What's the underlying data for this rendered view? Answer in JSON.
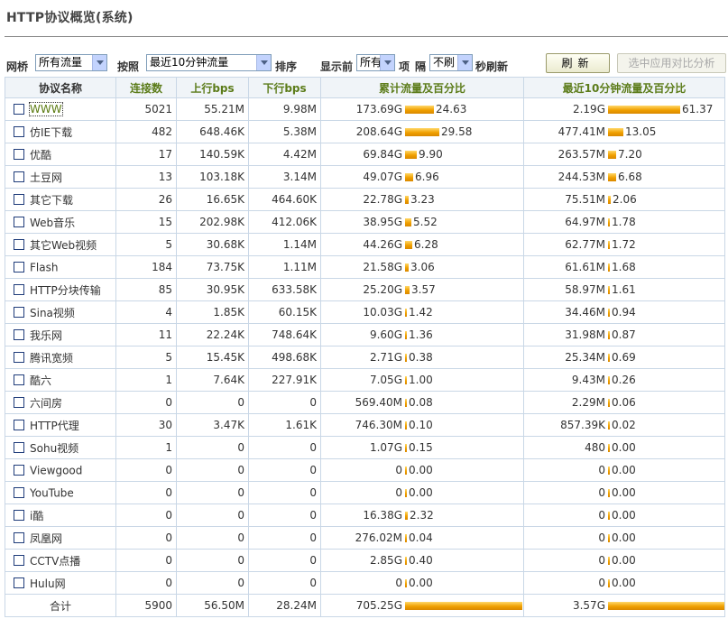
{
  "page": {
    "title": "HTTP协议概览(系统)"
  },
  "toolbar": {
    "bridge_label": "网桥",
    "bridge_value": "所有流量",
    "by_label": "按照",
    "period_value": "最近10分钟流量",
    "sort_label": "排序",
    "show_label": "显示前",
    "show_value": "所有",
    "items_label": "项",
    "interval_label": "隔",
    "refresh_value": "不刷",
    "seconds_label": "秒刷新",
    "refresh_button": "刷新",
    "compare_button": "选中应用对比分析"
  },
  "columns": [
    "协议名称",
    "连接数",
    "上行bps",
    "下行bps",
    "累计流量及百分比",
    "最近10分钟流量及百分比"
  ],
  "rows": [
    {
      "name": "WWW",
      "conns": "5021",
      "up": "55.21M",
      "down": "9.98M",
      "total": "173.69G",
      "total_pct": "24.63",
      "total_frac": 0.2463,
      "recent": "2.19G",
      "recent_pct": "61.37",
      "recent_frac": 0.6137
    },
    {
      "name": "仿IE下载",
      "conns": "482",
      "up": "648.46K",
      "down": "5.38M",
      "total": "208.64G",
      "total_pct": "29.58",
      "total_frac": 0.2958,
      "recent": "477.41M",
      "recent_pct": "13.05",
      "recent_frac": 0.1305
    },
    {
      "name": "优酷",
      "conns": "17",
      "up": "140.59K",
      "down": "4.42M",
      "total": "69.84G",
      "total_pct": "9.90",
      "total_frac": 0.099,
      "recent": "263.57M",
      "recent_pct": "7.20",
      "recent_frac": 0.072
    },
    {
      "name": "土豆网",
      "conns": "13",
      "up": "103.18K",
      "down": "3.14M",
      "total": "49.07G",
      "total_pct": "6.96",
      "total_frac": 0.0696,
      "recent": "244.53M",
      "recent_pct": "6.68",
      "recent_frac": 0.0668
    },
    {
      "name": "其它下载",
      "conns": "26",
      "up": "16.65K",
      "down": "464.60K",
      "total": "22.78G",
      "total_pct": "3.23",
      "total_frac": 0.0323,
      "recent": "75.51M",
      "recent_pct": "2.06",
      "recent_frac": 0.0206
    },
    {
      "name": "Web音乐",
      "conns": "15",
      "up": "202.98K",
      "down": "412.06K",
      "total": "38.95G",
      "total_pct": "5.52",
      "total_frac": 0.0552,
      "recent": "64.97M",
      "recent_pct": "1.78",
      "recent_frac": 0.0178
    },
    {
      "name": "其它Web视频",
      "conns": "5",
      "up": "30.68K",
      "down": "1.14M",
      "total": "44.26G",
      "total_pct": "6.28",
      "total_frac": 0.0628,
      "recent": "62.77M",
      "recent_pct": "1.72",
      "recent_frac": 0.0172
    },
    {
      "name": "Flash",
      "conns": "184",
      "up": "73.75K",
      "down": "1.11M",
      "total": "21.58G",
      "total_pct": "3.06",
      "total_frac": 0.0306,
      "recent": "61.61M",
      "recent_pct": "1.68",
      "recent_frac": 0.0168
    },
    {
      "name": "HTTP分块传输",
      "conns": "85",
      "up": "30.95K",
      "down": "633.58K",
      "total": "25.20G",
      "total_pct": "3.57",
      "total_frac": 0.0357,
      "recent": "58.97M",
      "recent_pct": "1.61",
      "recent_frac": 0.0161
    },
    {
      "name": "Sina视频",
      "conns": "4",
      "up": "1.85K",
      "down": "60.15K",
      "total": "10.03G",
      "total_pct": "1.42",
      "total_frac": 0.0142,
      "recent": "34.46M",
      "recent_pct": "0.94",
      "recent_frac": 0.0094
    },
    {
      "name": "我乐网",
      "conns": "11",
      "up": "22.24K",
      "down": "748.64K",
      "total": "9.60G",
      "total_pct": "1.36",
      "total_frac": 0.0136,
      "recent": "31.98M",
      "recent_pct": "0.87",
      "recent_frac": 0.0087
    },
    {
      "name": "腾讯宽频",
      "conns": "5",
      "up": "15.45K",
      "down": "498.68K",
      "total": "2.71G",
      "total_pct": "0.38",
      "total_frac": 0.0038,
      "recent": "25.34M",
      "recent_pct": "0.69",
      "recent_frac": 0.0069
    },
    {
      "name": "酷六",
      "conns": "1",
      "up": "7.64K",
      "down": "227.91K",
      "total": "7.05G",
      "total_pct": "1.00",
      "total_frac": 0.01,
      "recent": "9.43M",
      "recent_pct": "0.26",
      "recent_frac": 0.0026
    },
    {
      "name": "六间房",
      "conns": "0",
      "up": "0",
      "down": "0",
      "total": "569.40M",
      "total_pct": "0.08",
      "total_frac": 0.0008,
      "recent": "2.29M",
      "recent_pct": "0.06",
      "recent_frac": 0.0006
    },
    {
      "name": "HTTP代理",
      "conns": "30",
      "up": "3.47K",
      "down": "1.61K",
      "total": "746.30M",
      "total_pct": "0.10",
      "total_frac": 0.001,
      "recent": "857.39K",
      "recent_pct": "0.02",
      "recent_frac": 0.0002
    },
    {
      "name": "Sohu视频",
      "conns": "1",
      "up": "0",
      "down": "0",
      "total": "1.07G",
      "total_pct": "0.15",
      "total_frac": 0.0015,
      "recent": "480",
      "recent_pct": "0.00",
      "recent_frac": 0
    },
    {
      "name": "Viewgood",
      "conns": "0",
      "up": "0",
      "down": "0",
      "total": "0",
      "total_pct": "0.00",
      "total_frac": 0,
      "recent": "0",
      "recent_pct": "0.00",
      "recent_frac": 0
    },
    {
      "name": "YouTube",
      "conns": "0",
      "up": "0",
      "down": "0",
      "total": "0",
      "total_pct": "0.00",
      "total_frac": 0,
      "recent": "0",
      "recent_pct": "0.00",
      "recent_frac": 0
    },
    {
      "name": "i酷",
      "conns": "0",
      "up": "0",
      "down": "0",
      "total": "16.38G",
      "total_pct": "2.32",
      "total_frac": 0.0232,
      "recent": "0",
      "recent_pct": "0.00",
      "recent_frac": 0
    },
    {
      "name": "凤凰网",
      "conns": "0",
      "up": "0",
      "down": "0",
      "total": "276.02M",
      "total_pct": "0.04",
      "total_frac": 0.0004,
      "recent": "0",
      "recent_pct": "0.00",
      "recent_frac": 0
    },
    {
      "name": "CCTV点播",
      "conns": "0",
      "up": "0",
      "down": "0",
      "total": "2.85G",
      "total_pct": "0.40",
      "total_frac": 0.004,
      "recent": "0",
      "recent_pct": "0.00",
      "recent_frac": 0
    },
    {
      "name": "Hulu网",
      "conns": "0",
      "up": "0",
      "down": "0",
      "total": "0",
      "total_pct": "0.00",
      "total_frac": 0,
      "recent": "0",
      "recent_pct": "0.00",
      "recent_frac": 0
    }
  ],
  "totals": {
    "label": "合计",
    "conns": "5900",
    "up": "56.50M",
    "down": "28.24M",
    "total": "705.25G",
    "total_pct": "100.00",
    "total_frac": 1,
    "recent": "3.57G",
    "recent_pct": "100.00",
    "recent_frac": 1
  },
  "colors": {
    "accent_green": "#5c7c1a",
    "bar_orange": "#f0a000",
    "grid_border": "#c9d7e6"
  }
}
